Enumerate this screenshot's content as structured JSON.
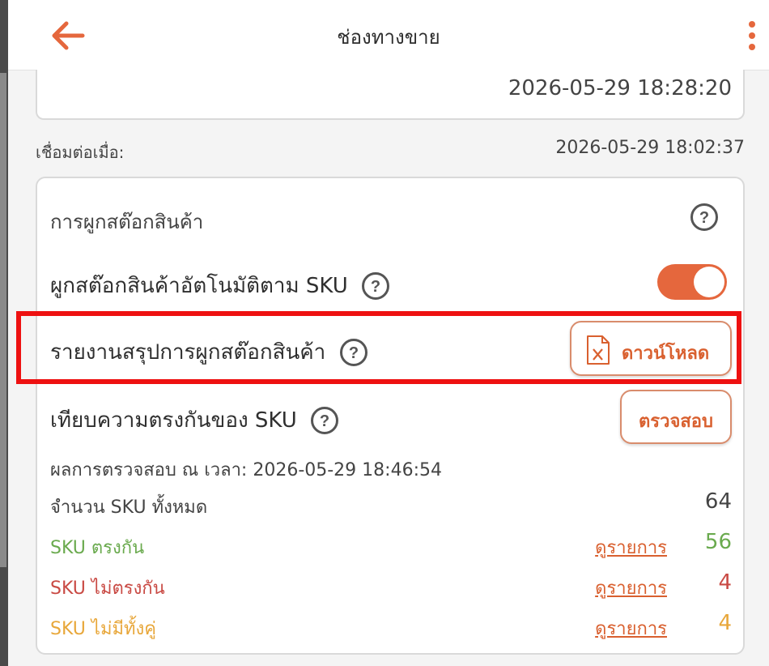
{
  "header": {
    "title": "ช่องทางขาย",
    "back_icon": "arrow-left-icon",
    "menu_icon": "kebab-menu-icon"
  },
  "previous_card": {
    "value": "2026-05-29 18:28:20"
  },
  "connected": {
    "label": "เชื่อมต่อเมื่อ:",
    "value": "2026-05-29 18:02:37"
  },
  "stock_binding": {
    "title": "การผูกสต๊อกสินค้า",
    "auto_bind": {
      "label": "ผูกสต๊อกสินค้าอัตโนมัติตาม SKU",
      "enabled": true
    },
    "report": {
      "label": "รายงานสรุปการผูกสต๊อกสินค้า",
      "download_label": "ดาวน์โหลด",
      "download_icon": "excel-file-icon"
    },
    "compare": {
      "label": "เทียบความตรงกันของ SKU",
      "check_label": "ตรวจสอบ"
    },
    "checked_at": "ผลการตรวจสอบ ณ เวลา: 2026-05-29 18:46:54",
    "stats": {
      "total": {
        "label": "จำนวน SKU ทั้งหมด",
        "value": "64"
      },
      "matched": {
        "label": "SKU ตรงกัน",
        "link": "ดูรายการ",
        "value": "56"
      },
      "mismatched": {
        "label": "SKU ไม่ตรงกัน",
        "link": "ดูรายการ",
        "value": "4"
      },
      "missing": {
        "label": "SKU ไม่มีทั้งคู่",
        "link": "ดูรายการ",
        "value": "4"
      }
    }
  },
  "colors": {
    "accent": "#e5673d",
    "highlight": "#ee1111",
    "matched": "#6aaa4e",
    "mismatched": "#c94a44",
    "missing": "#e8a73a"
  }
}
